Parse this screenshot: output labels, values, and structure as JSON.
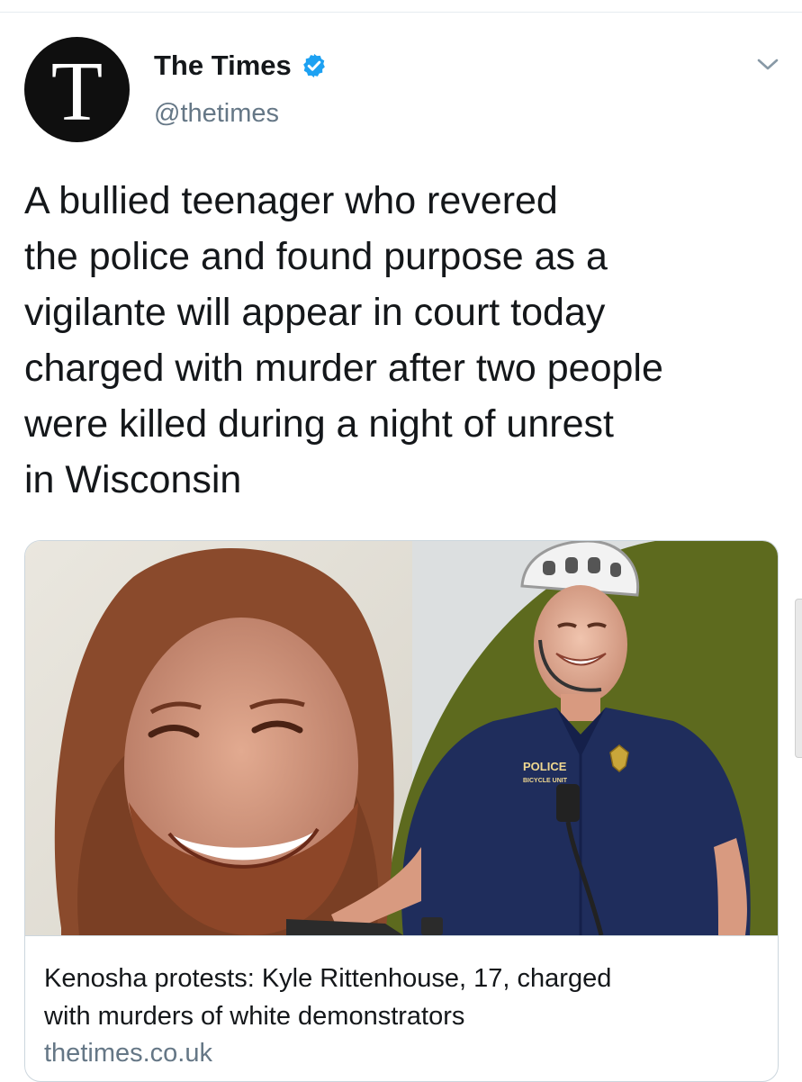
{
  "tweet": {
    "author": {
      "avatar_letter": "T",
      "display_name": "The Times",
      "handle": "@thetimes",
      "verified_icon": "verified-badge-icon",
      "verified_color": "#1da1f2"
    },
    "menu_icon": "chevron-down-icon",
    "text_lines": [
      "A bullied teenager who revered",
      "the police and found purpose as a",
      "vigilante will appear in court today",
      "charged with murder after two people",
      "were killed during a night of unrest",
      "in Wisconsin"
    ],
    "card": {
      "image_badge_text": "POLICE",
      "image_badge_subtext": "BICYCLE UNIT",
      "title_lines": [
        "Kenosha protests: Kyle Rittenhouse, 17, charged",
        "with murders of white demonstrators"
      ],
      "domain": "thetimes.co.uk"
    }
  },
  "colors": {
    "text_primary": "#14171a",
    "text_secondary": "#657786",
    "border": "#ccd6dd",
    "image_green": "#5d6a1e"
  }
}
